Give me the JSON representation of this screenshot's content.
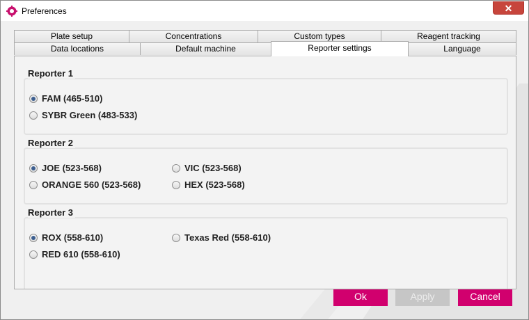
{
  "window": {
    "title": "Preferences",
    "close_label": "✕",
    "app_icon": "gear-icon",
    "accent_color": "#d1006e"
  },
  "tabs": {
    "row1": [
      "Plate setup",
      "Concentrations",
      "Custom types",
      "Reagent tracking"
    ],
    "row2": [
      "Data locations",
      "Default machine",
      "Reporter settings",
      "Language"
    ],
    "active": "Reporter settings"
  },
  "reporters": [
    {
      "label": "Reporter 1",
      "options": [
        {
          "label": "FAM (465-510)",
          "checked": true
        },
        {
          "label": "SYBR Green (483-533)",
          "checked": false
        }
      ]
    },
    {
      "label": "Reporter 2",
      "options": [
        {
          "label": "JOE (523-568)",
          "checked": true
        },
        {
          "label": "ORANGE 560 (523-568)",
          "checked": false
        },
        {
          "label": "VIC (523-568)",
          "checked": false
        },
        {
          "label": "HEX (523-568)",
          "checked": false
        }
      ]
    },
    {
      "label": "Reporter 3",
      "options": [
        {
          "label": "ROX (558-610)",
          "checked": true
        },
        {
          "label": "RED 610 (558-610)",
          "checked": false
        },
        {
          "label": "Texas Red (558-610)",
          "checked": false
        }
      ]
    }
  ],
  "buttons": {
    "ok": "Ok",
    "apply": "Apply",
    "cancel": "Cancel"
  }
}
